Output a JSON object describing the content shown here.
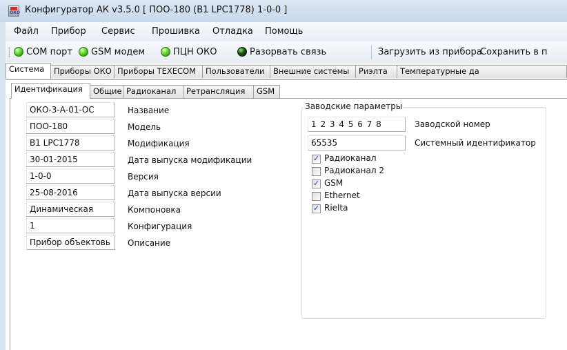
{
  "window": {
    "title": "Конфигуратор АК v3.5.0 [ ПОО-180 (B1 LPC1778) 1-0-0 ]",
    "icon_text": "ОКО"
  },
  "menu": [
    "Файл",
    "Прибор",
    "Сервис",
    "Прошивка",
    "Отладка",
    "Помощь"
  ],
  "toolbar": {
    "com_port": "COM порт",
    "gsm_modem": "GSM модем",
    "pcn_oko": "ПЦН ОКО",
    "disconnect": "Разорвать связь",
    "load_from_device": "Загрузить из прибора",
    "save_to_device": "Сохранить в п",
    "led_colors": {
      "connected": "#2f9a13",
      "disconnect": "#1c4d12"
    }
  },
  "main_tabs": [
    "Система",
    "Приборы ОКО",
    "Приборы TEXECOM",
    "Пользователи",
    "Внешние системы",
    "Риэлта",
    "Температурные да"
  ],
  "sub_tabs": [
    "Идентификация",
    "Общие",
    "Радиоканал",
    "Ретрансляция",
    "GSM"
  ],
  "fields": [
    {
      "value": "ОКО-3-А-01-ОС",
      "label": "Название"
    },
    {
      "value": "ПОО-180",
      "label": "Модель"
    },
    {
      "value": "B1 LPC1778",
      "label": "Модификация"
    },
    {
      "value": "30-01-2015",
      "label": "Дата выпуска модификации"
    },
    {
      "value": "1-0-0",
      "label": "Версия"
    },
    {
      "value": "25-08-2016",
      "label": "Дата выпуска версии"
    },
    {
      "value": "Динамическая",
      "label": "Компоновка"
    },
    {
      "value": "1",
      "label": "Конфигурация"
    },
    {
      "value": "Прибор объектовь",
      "label": "Описание"
    }
  ],
  "factory": {
    "title": "Заводские параметры",
    "serial_value": "1 2 3 4 5 6 7 8",
    "serial_label": "Заводской номер",
    "sysid_value": "65535",
    "sysid_label": "Системный идентификатор",
    "options": [
      {
        "label": "Радиоканал",
        "checked": true
      },
      {
        "label": "Радиоканал 2",
        "checked": false
      },
      {
        "label": "GSM",
        "checked": true
      },
      {
        "label": "Ethernet",
        "checked": false
      },
      {
        "label": "Rielta",
        "checked": true
      }
    ]
  }
}
